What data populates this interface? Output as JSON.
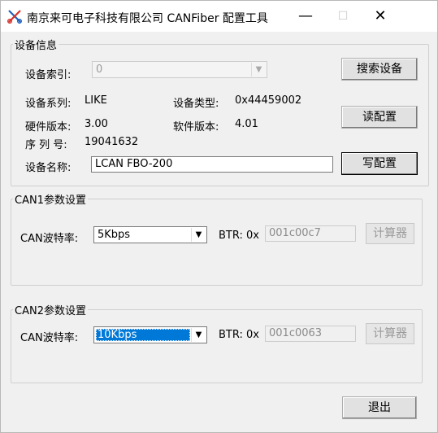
{
  "window": {
    "title": "南京来可电子科技有限公司 CANFiber 配置工具",
    "minimize_glyph": "—",
    "maximize_glyph": "☐",
    "close_glyph": "✕"
  },
  "device_info": {
    "group_title": "设备信息",
    "index_label": "设备索引:",
    "index_value": "0",
    "series_label": "设备系列:",
    "series_value": "LIKE",
    "type_label": "设备类型:",
    "type_value": "0x44459002",
    "hw_label": "硬件版本:",
    "hw_value": "3.00",
    "sw_label": "软件版本:",
    "sw_value": "4.01",
    "serial_label": "序 列 号:",
    "serial_value": "19041632",
    "name_label": "设备名称:",
    "name_value": "LCAN FBO-200",
    "search_button": "搜索设备",
    "read_button": "读配置",
    "write_button": "写配置"
  },
  "can1": {
    "group_title": "CAN1参数设置",
    "baud_label": "CAN波特率:",
    "baud_value": "5Kbps",
    "btr_label": "BTR: 0x",
    "btr_value": "001c00c7",
    "calc_button": "计算器"
  },
  "can2": {
    "group_title": "CAN2参数设置",
    "baud_label": "CAN波特率:",
    "baud_value": "10Kbps",
    "btr_label": "BTR: 0x",
    "btr_value": "001c0063",
    "calc_button": "计算器"
  },
  "footer": {
    "exit_button": "退出"
  },
  "icons": {
    "app": "scissors-icon",
    "dropdown": "chevron-down-icon"
  },
  "colors": {
    "selection": "#0078d7",
    "window_bg": "#f0f0f0"
  }
}
